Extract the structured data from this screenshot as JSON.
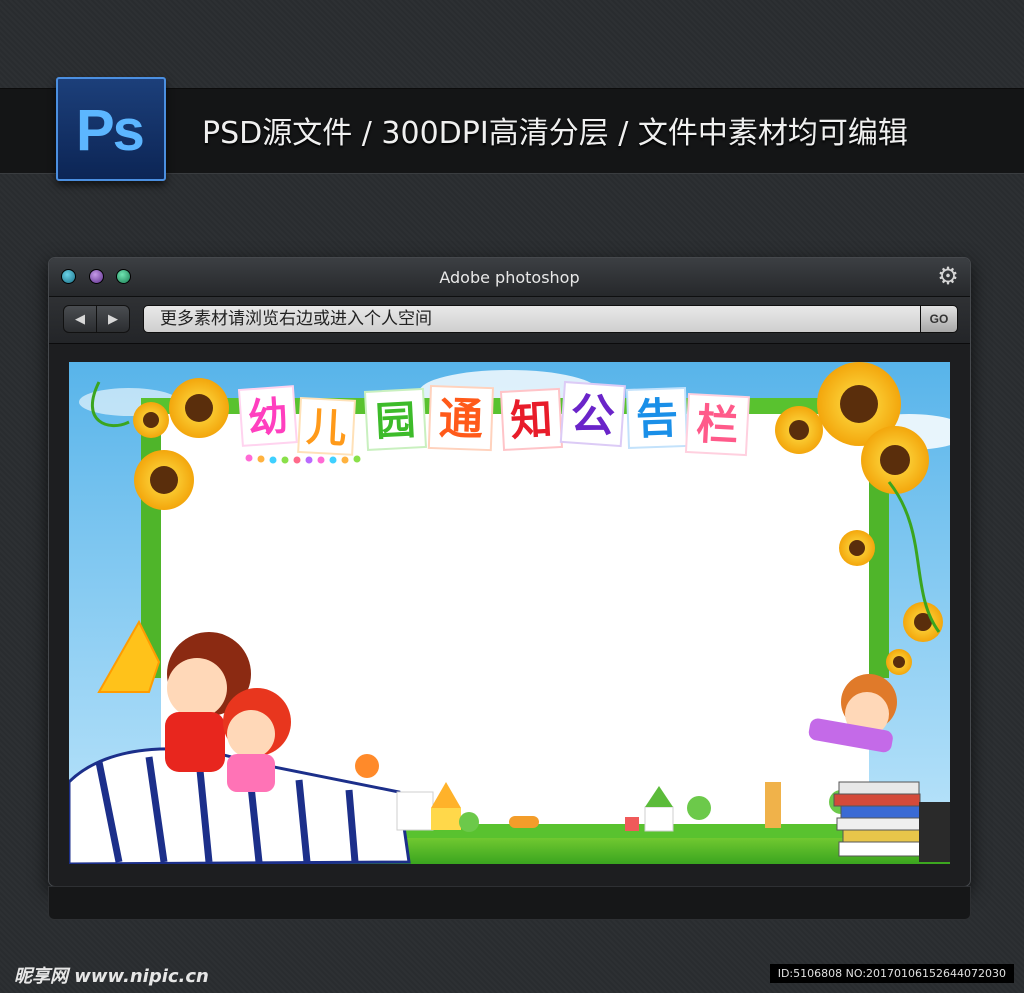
{
  "header": {
    "logo_text": "Ps",
    "title": "PSD源文件 / 300DPI高清分层  / 文件中素材均可编辑"
  },
  "window": {
    "title": "Adobe photoshop",
    "address_text": "更多素材请浏览右边或进入个人空间",
    "go_label": "GO"
  },
  "banner": {
    "chars": [
      {
        "ch": "幼",
        "color": "#ff3fbf"
      },
      {
        "ch": "儿",
        "color": "#ff9a1a"
      },
      {
        "ch": "园",
        "color": "#3dbb2a"
      },
      {
        "ch": "通",
        "color": "#ff5a1a"
      },
      {
        "ch": "知",
        "color": "#e81c2a"
      },
      {
        "ch": "公",
        "color": "#6a24c9"
      },
      {
        "ch": "告",
        "color": "#1a8fe8"
      },
      {
        "ch": "栏",
        "color": "#ff5a8a"
      }
    ]
  },
  "footer": {
    "watermark": "昵享网 www.nipic.cn",
    "id_text": "ID:5106808 NO:20170106152644072030"
  }
}
